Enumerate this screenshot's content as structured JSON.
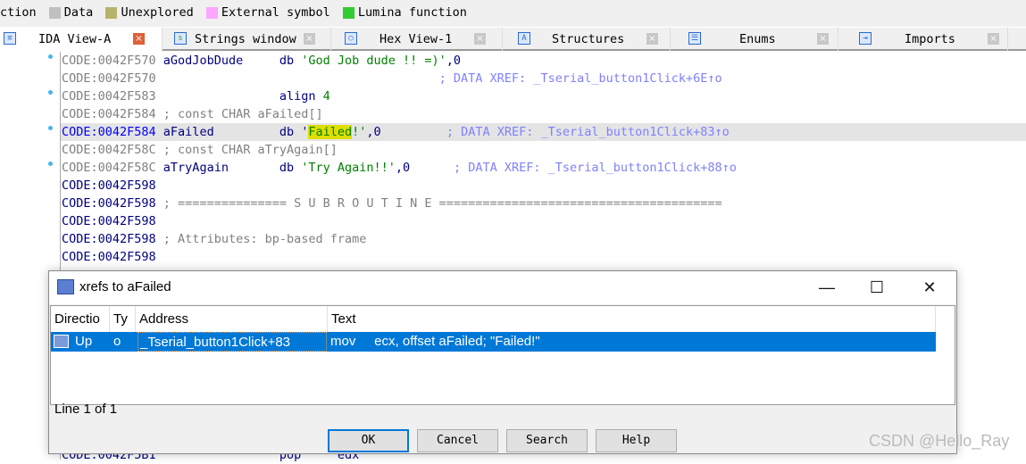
{
  "legend": [
    {
      "label": "ction",
      "color": null
    },
    {
      "label": "Data",
      "color": "#c0c0c0"
    },
    {
      "label": "Unexplored",
      "color": "#b5b56a"
    },
    {
      "label": "External symbol",
      "color": "#ffa6ff"
    },
    {
      "label": "Lumina function",
      "color": "#33cc33"
    }
  ],
  "tabs": [
    {
      "label": "IDA View-A",
      "icon": "disassembly-icon",
      "active": true
    },
    {
      "label": "Strings window",
      "icon": "strings-icon"
    },
    {
      "label": "Hex View-1",
      "icon": "hex-icon"
    },
    {
      "label": "Structures",
      "icon": "structures-icon"
    },
    {
      "label": "Enums",
      "icon": "enums-icon"
    },
    {
      "label": "Imports",
      "icon": "imports-icon"
    }
  ],
  "code": {
    "l0": {
      "addr": "CODE:0042F570",
      "rest": " aGodJobDude     db ",
      "str": "'God Job dude !! =)'",
      "tail": ",0"
    },
    "l1": {
      "addr": "CODE:0042F570",
      "xref": "                                       ; DATA XREF: _Tserial_button1Click+6E↑o"
    },
    "l2": {
      "addr": "CODE:0042F583",
      "rest": "                 align ",
      "str": "4"
    },
    "l3": {
      "addr": "CODE:0042F584",
      "cmt": " ; const CHAR aFailed[]"
    },
    "l4": {
      "addr": "CODE:0042F584",
      "rest": " aFailed         db '",
      "mark": "Failed",
      "str": "!'",
      "tail": ",0",
      "xref": "         ; DATA XREF: _Tserial_button1Click+83↑o"
    },
    "l5": {
      "addr": "CODE:0042F58C",
      "cmt": " ; const CHAR aTryAgain[]"
    },
    "l6": {
      "addr": "CODE:0042F58C",
      "rest": " aTryAgain       db ",
      "str": "'Try Again!!'",
      "tail": ",0",
      "xref": "      ; DATA XREF: _Tserial_button1Click+88↑o"
    },
    "l7": {
      "addr": "CODE:0042F598"
    },
    "l8": {
      "addr": "CODE:0042F598",
      "cmt": " ; =============== S U B R O U T I N E ======================================="
    },
    "l9": {
      "addr": "CODE:0042F598"
    },
    "l10": {
      "addr": "CODE:0042F598",
      "cmt": " ; Attributes: bp-based frame"
    },
    "l11": {
      "addr": "CODE:0042F598"
    },
    "l12": {
      "addr": "CODE:0042F5B1",
      "rest": "                 pop     edx"
    }
  },
  "dialog": {
    "title": "xrefs to aFailed",
    "minimize": "—",
    "maximize": "☐",
    "close": "✕",
    "columns": [
      "Directio",
      "Ty",
      "Address",
      "Text"
    ],
    "rows": [
      {
        "direction": "Up",
        "type": "o",
        "address": "_Tserial_button1Click+83",
        "text": "mov     ecx, offset aFailed; \"Failed!\""
      }
    ],
    "status": "Line 1 of 1",
    "buttons": {
      "ok": "OK",
      "cancel": "Cancel",
      "search": "Search",
      "help": "Help"
    }
  },
  "watermark": "CSDN @Hello_Ray"
}
